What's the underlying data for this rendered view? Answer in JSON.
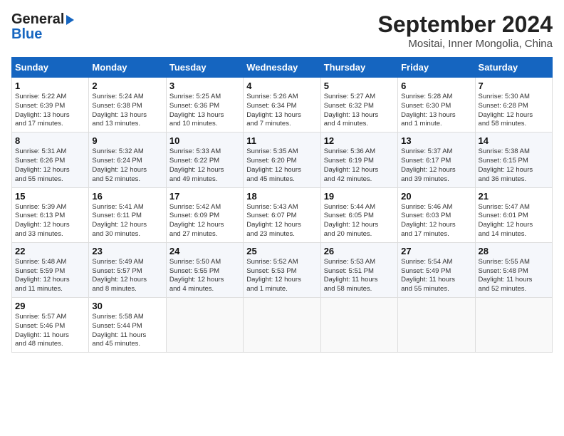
{
  "logo": {
    "line1": "General",
    "line2": "Blue"
  },
  "title": "September 2024",
  "subtitle": "Mositai, Inner Mongolia, China",
  "days": [
    "Sunday",
    "Monday",
    "Tuesday",
    "Wednesday",
    "Thursday",
    "Friday",
    "Saturday"
  ],
  "weeks": [
    [
      {
        "num": "1",
        "text": "Sunrise: 5:22 AM\nSunset: 6:39 PM\nDaylight: 13 hours\nand 17 minutes."
      },
      {
        "num": "2",
        "text": "Sunrise: 5:24 AM\nSunset: 6:38 PM\nDaylight: 13 hours\nand 13 minutes."
      },
      {
        "num": "3",
        "text": "Sunrise: 5:25 AM\nSunset: 6:36 PM\nDaylight: 13 hours\nand 10 minutes."
      },
      {
        "num": "4",
        "text": "Sunrise: 5:26 AM\nSunset: 6:34 PM\nDaylight: 13 hours\nand 7 minutes."
      },
      {
        "num": "5",
        "text": "Sunrise: 5:27 AM\nSunset: 6:32 PM\nDaylight: 13 hours\nand 4 minutes."
      },
      {
        "num": "6",
        "text": "Sunrise: 5:28 AM\nSunset: 6:30 PM\nDaylight: 13 hours\nand 1 minute."
      },
      {
        "num": "7",
        "text": "Sunrise: 5:30 AM\nSunset: 6:28 PM\nDaylight: 12 hours\nand 58 minutes."
      }
    ],
    [
      {
        "num": "8",
        "text": "Sunrise: 5:31 AM\nSunset: 6:26 PM\nDaylight: 12 hours\nand 55 minutes."
      },
      {
        "num": "9",
        "text": "Sunrise: 5:32 AM\nSunset: 6:24 PM\nDaylight: 12 hours\nand 52 minutes."
      },
      {
        "num": "10",
        "text": "Sunrise: 5:33 AM\nSunset: 6:22 PM\nDaylight: 12 hours\nand 49 minutes."
      },
      {
        "num": "11",
        "text": "Sunrise: 5:35 AM\nSunset: 6:20 PM\nDaylight: 12 hours\nand 45 minutes."
      },
      {
        "num": "12",
        "text": "Sunrise: 5:36 AM\nSunset: 6:19 PM\nDaylight: 12 hours\nand 42 minutes."
      },
      {
        "num": "13",
        "text": "Sunrise: 5:37 AM\nSunset: 6:17 PM\nDaylight: 12 hours\nand 39 minutes."
      },
      {
        "num": "14",
        "text": "Sunrise: 5:38 AM\nSunset: 6:15 PM\nDaylight: 12 hours\nand 36 minutes."
      }
    ],
    [
      {
        "num": "15",
        "text": "Sunrise: 5:39 AM\nSunset: 6:13 PM\nDaylight: 12 hours\nand 33 minutes."
      },
      {
        "num": "16",
        "text": "Sunrise: 5:41 AM\nSunset: 6:11 PM\nDaylight: 12 hours\nand 30 minutes."
      },
      {
        "num": "17",
        "text": "Sunrise: 5:42 AM\nSunset: 6:09 PM\nDaylight: 12 hours\nand 27 minutes."
      },
      {
        "num": "18",
        "text": "Sunrise: 5:43 AM\nSunset: 6:07 PM\nDaylight: 12 hours\nand 23 minutes."
      },
      {
        "num": "19",
        "text": "Sunrise: 5:44 AM\nSunset: 6:05 PM\nDaylight: 12 hours\nand 20 minutes."
      },
      {
        "num": "20",
        "text": "Sunrise: 5:46 AM\nSunset: 6:03 PM\nDaylight: 12 hours\nand 17 minutes."
      },
      {
        "num": "21",
        "text": "Sunrise: 5:47 AM\nSunset: 6:01 PM\nDaylight: 12 hours\nand 14 minutes."
      }
    ],
    [
      {
        "num": "22",
        "text": "Sunrise: 5:48 AM\nSunset: 5:59 PM\nDaylight: 12 hours\nand 11 minutes."
      },
      {
        "num": "23",
        "text": "Sunrise: 5:49 AM\nSunset: 5:57 PM\nDaylight: 12 hours\nand 8 minutes."
      },
      {
        "num": "24",
        "text": "Sunrise: 5:50 AM\nSunset: 5:55 PM\nDaylight: 12 hours\nand 4 minutes."
      },
      {
        "num": "25",
        "text": "Sunrise: 5:52 AM\nSunset: 5:53 PM\nDaylight: 12 hours\nand 1 minute."
      },
      {
        "num": "26",
        "text": "Sunrise: 5:53 AM\nSunset: 5:51 PM\nDaylight: 11 hours\nand 58 minutes."
      },
      {
        "num": "27",
        "text": "Sunrise: 5:54 AM\nSunset: 5:49 PM\nDaylight: 11 hours\nand 55 minutes."
      },
      {
        "num": "28",
        "text": "Sunrise: 5:55 AM\nSunset: 5:48 PM\nDaylight: 11 hours\nand 52 minutes."
      }
    ],
    [
      {
        "num": "29",
        "text": "Sunrise: 5:57 AM\nSunset: 5:46 PM\nDaylight: 11 hours\nand 48 minutes."
      },
      {
        "num": "30",
        "text": "Sunrise: 5:58 AM\nSunset: 5:44 PM\nDaylight: 11 hours\nand 45 minutes."
      },
      null,
      null,
      null,
      null,
      null
    ]
  ]
}
